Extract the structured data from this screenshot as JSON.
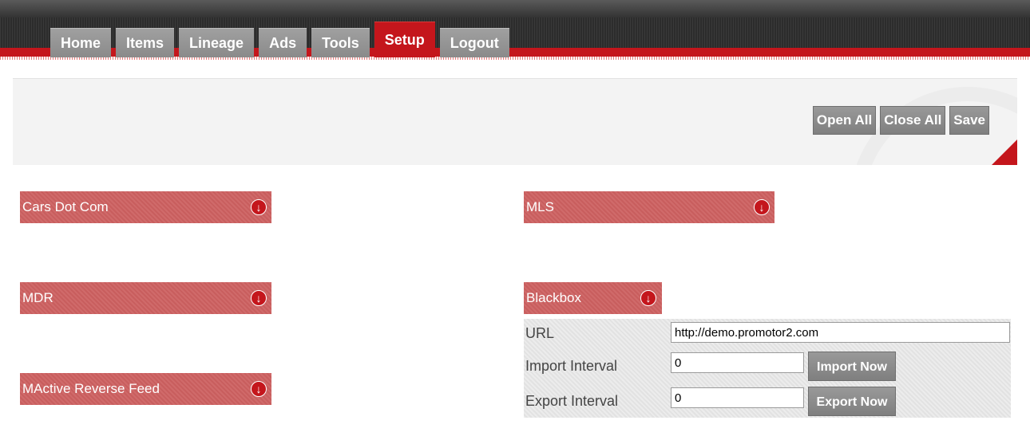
{
  "nav": {
    "tabs": [
      {
        "label": "Home"
      },
      {
        "label": "Items"
      },
      {
        "label": "Lineage"
      },
      {
        "label": "Ads"
      },
      {
        "label": "Tools"
      },
      {
        "label": "Setup",
        "active": true
      },
      {
        "label": "Logout"
      }
    ]
  },
  "toolbar": {
    "open_all": "Open All",
    "close_all": "Close All",
    "save": "Save"
  },
  "sections": {
    "cars_dot_com": "Cars Dot Com",
    "mls": "MLS",
    "mdr": "MDR",
    "blackbox": "Blackbox",
    "mactive": "MActive Reverse Feed"
  },
  "blackbox_form": {
    "url_label": "URL",
    "url_value": "http://demo.promotor2.com",
    "import_label": "Import Interval",
    "import_value": "0",
    "import_button": "Import Now",
    "export_label": "Export Interval",
    "export_value": "0",
    "export_button": "Export Now"
  },
  "colors": {
    "accent": "#c4161c",
    "section_bar": "#d06a6a",
    "tab_gray": "#8f8f8f"
  },
  "icons": {
    "section_toggle": "expand-arrow-down-icon",
    "corner": "red-corner-fold-icon"
  }
}
